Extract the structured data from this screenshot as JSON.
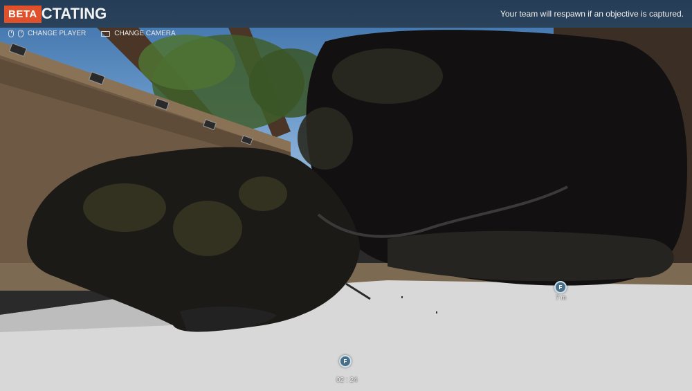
{
  "hud": {
    "beta_label": "BETA",
    "mode_label": "CTATING",
    "respawn_message": "Your team will respawn if an objective is captured."
  },
  "hints": [
    {
      "icon": "mouse-left-icon",
      "label": "CHANGE PLAYER"
    },
    {
      "icon": "camera-icon",
      "label": "CHANGE CAMERA"
    }
  ],
  "objectives": [
    {
      "letter": "F",
      "distance": "7 m"
    },
    {
      "letter": "F",
      "timer": "02 : 24"
    }
  ],
  "colors": {
    "beta_badge": "#e0502a",
    "marker_fill": "#4a6e86",
    "floor": "#d8d8d8"
  }
}
